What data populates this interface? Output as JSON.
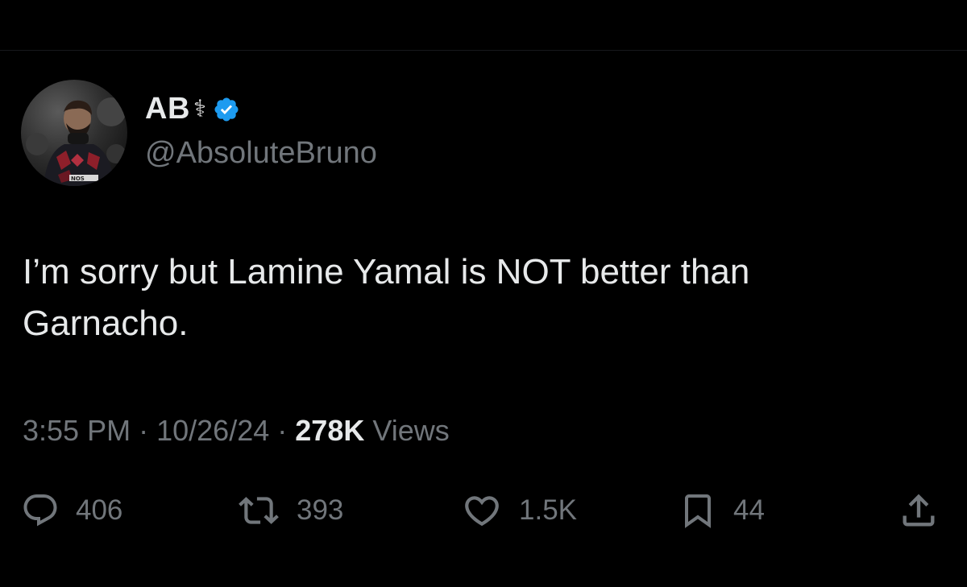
{
  "tweet": {
    "display_name": "AB",
    "name_emoji": "⚕",
    "handle": "@AbsoluteBruno",
    "text": "I’m sorry but Lamine Yamal is NOT better than Garnacho.",
    "time": "3:55 PM",
    "separator": "·",
    "date": "10/26/24",
    "views_count": "278K",
    "views_label": "Views"
  },
  "actions": {
    "replies": "406",
    "reposts": "393",
    "likes": "1.5K",
    "bookmarks": "44"
  },
  "icons": {
    "verified": "verified-badge-icon",
    "reply": "reply-icon",
    "repost": "repost-icon",
    "like": "heart-icon",
    "bookmark": "bookmark-icon",
    "share": "share-icon"
  },
  "colors": {
    "background": "#000000",
    "text": "#e7e9ea",
    "secondary": "#71767b",
    "verified": "#1d9bf0"
  }
}
